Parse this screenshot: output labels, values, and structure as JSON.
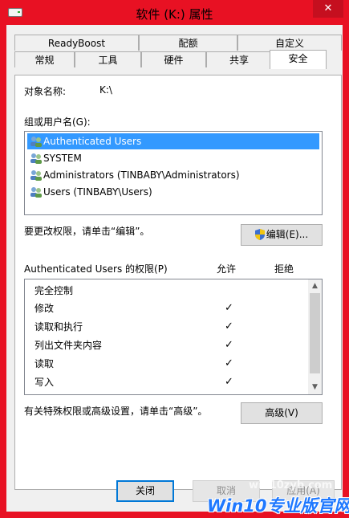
{
  "window": {
    "title": "软件 (K:) 属性",
    "close_glyph": "✕",
    "icon": "drive-icon"
  },
  "tabs": {
    "row1": [
      "ReadyBoost",
      "配额",
      "自定义"
    ],
    "row2": [
      "常规",
      "工具",
      "硬件",
      "共享",
      "安全"
    ],
    "active": "安全"
  },
  "security": {
    "object_label": "对象名称:",
    "object_value": "K:\\",
    "group_label": "组或用户名(G):",
    "users": [
      "Authenticated Users",
      "SYSTEM",
      "Administrators (TINBABY\\Administrators)",
      "Users (TINBABY\\Users)"
    ],
    "selected_user_index": 0,
    "change_hint": "要更改权限，请单击“编辑”。",
    "edit_button": "编辑(E)...",
    "perm_label": "Authenticated Users 的权限(P)",
    "allow_header": "允许",
    "deny_header": "拒绝",
    "permissions": [
      {
        "name": "完全控制",
        "allow": false
      },
      {
        "name": "修改",
        "allow": true
      },
      {
        "name": "读取和执行",
        "allow": true
      },
      {
        "name": "列出文件夹内容",
        "allow": true
      },
      {
        "name": "读取",
        "allow": true
      },
      {
        "name": "写入",
        "allow": true
      }
    ],
    "check_glyph": "✓",
    "advanced_hint": "有关特殊权限或高级设置，请单击“高级”。",
    "advanced_button": "高级(V)"
  },
  "footer": {
    "close_button": "关闭",
    "cancel_button": "取消",
    "apply_button": "应用(A)"
  },
  "watermark": {
    "site": "win10zyb.com",
    "brand": "Win10专业版官网"
  },
  "colors": {
    "frame": "#e81123",
    "selection": "#3399ff"
  }
}
